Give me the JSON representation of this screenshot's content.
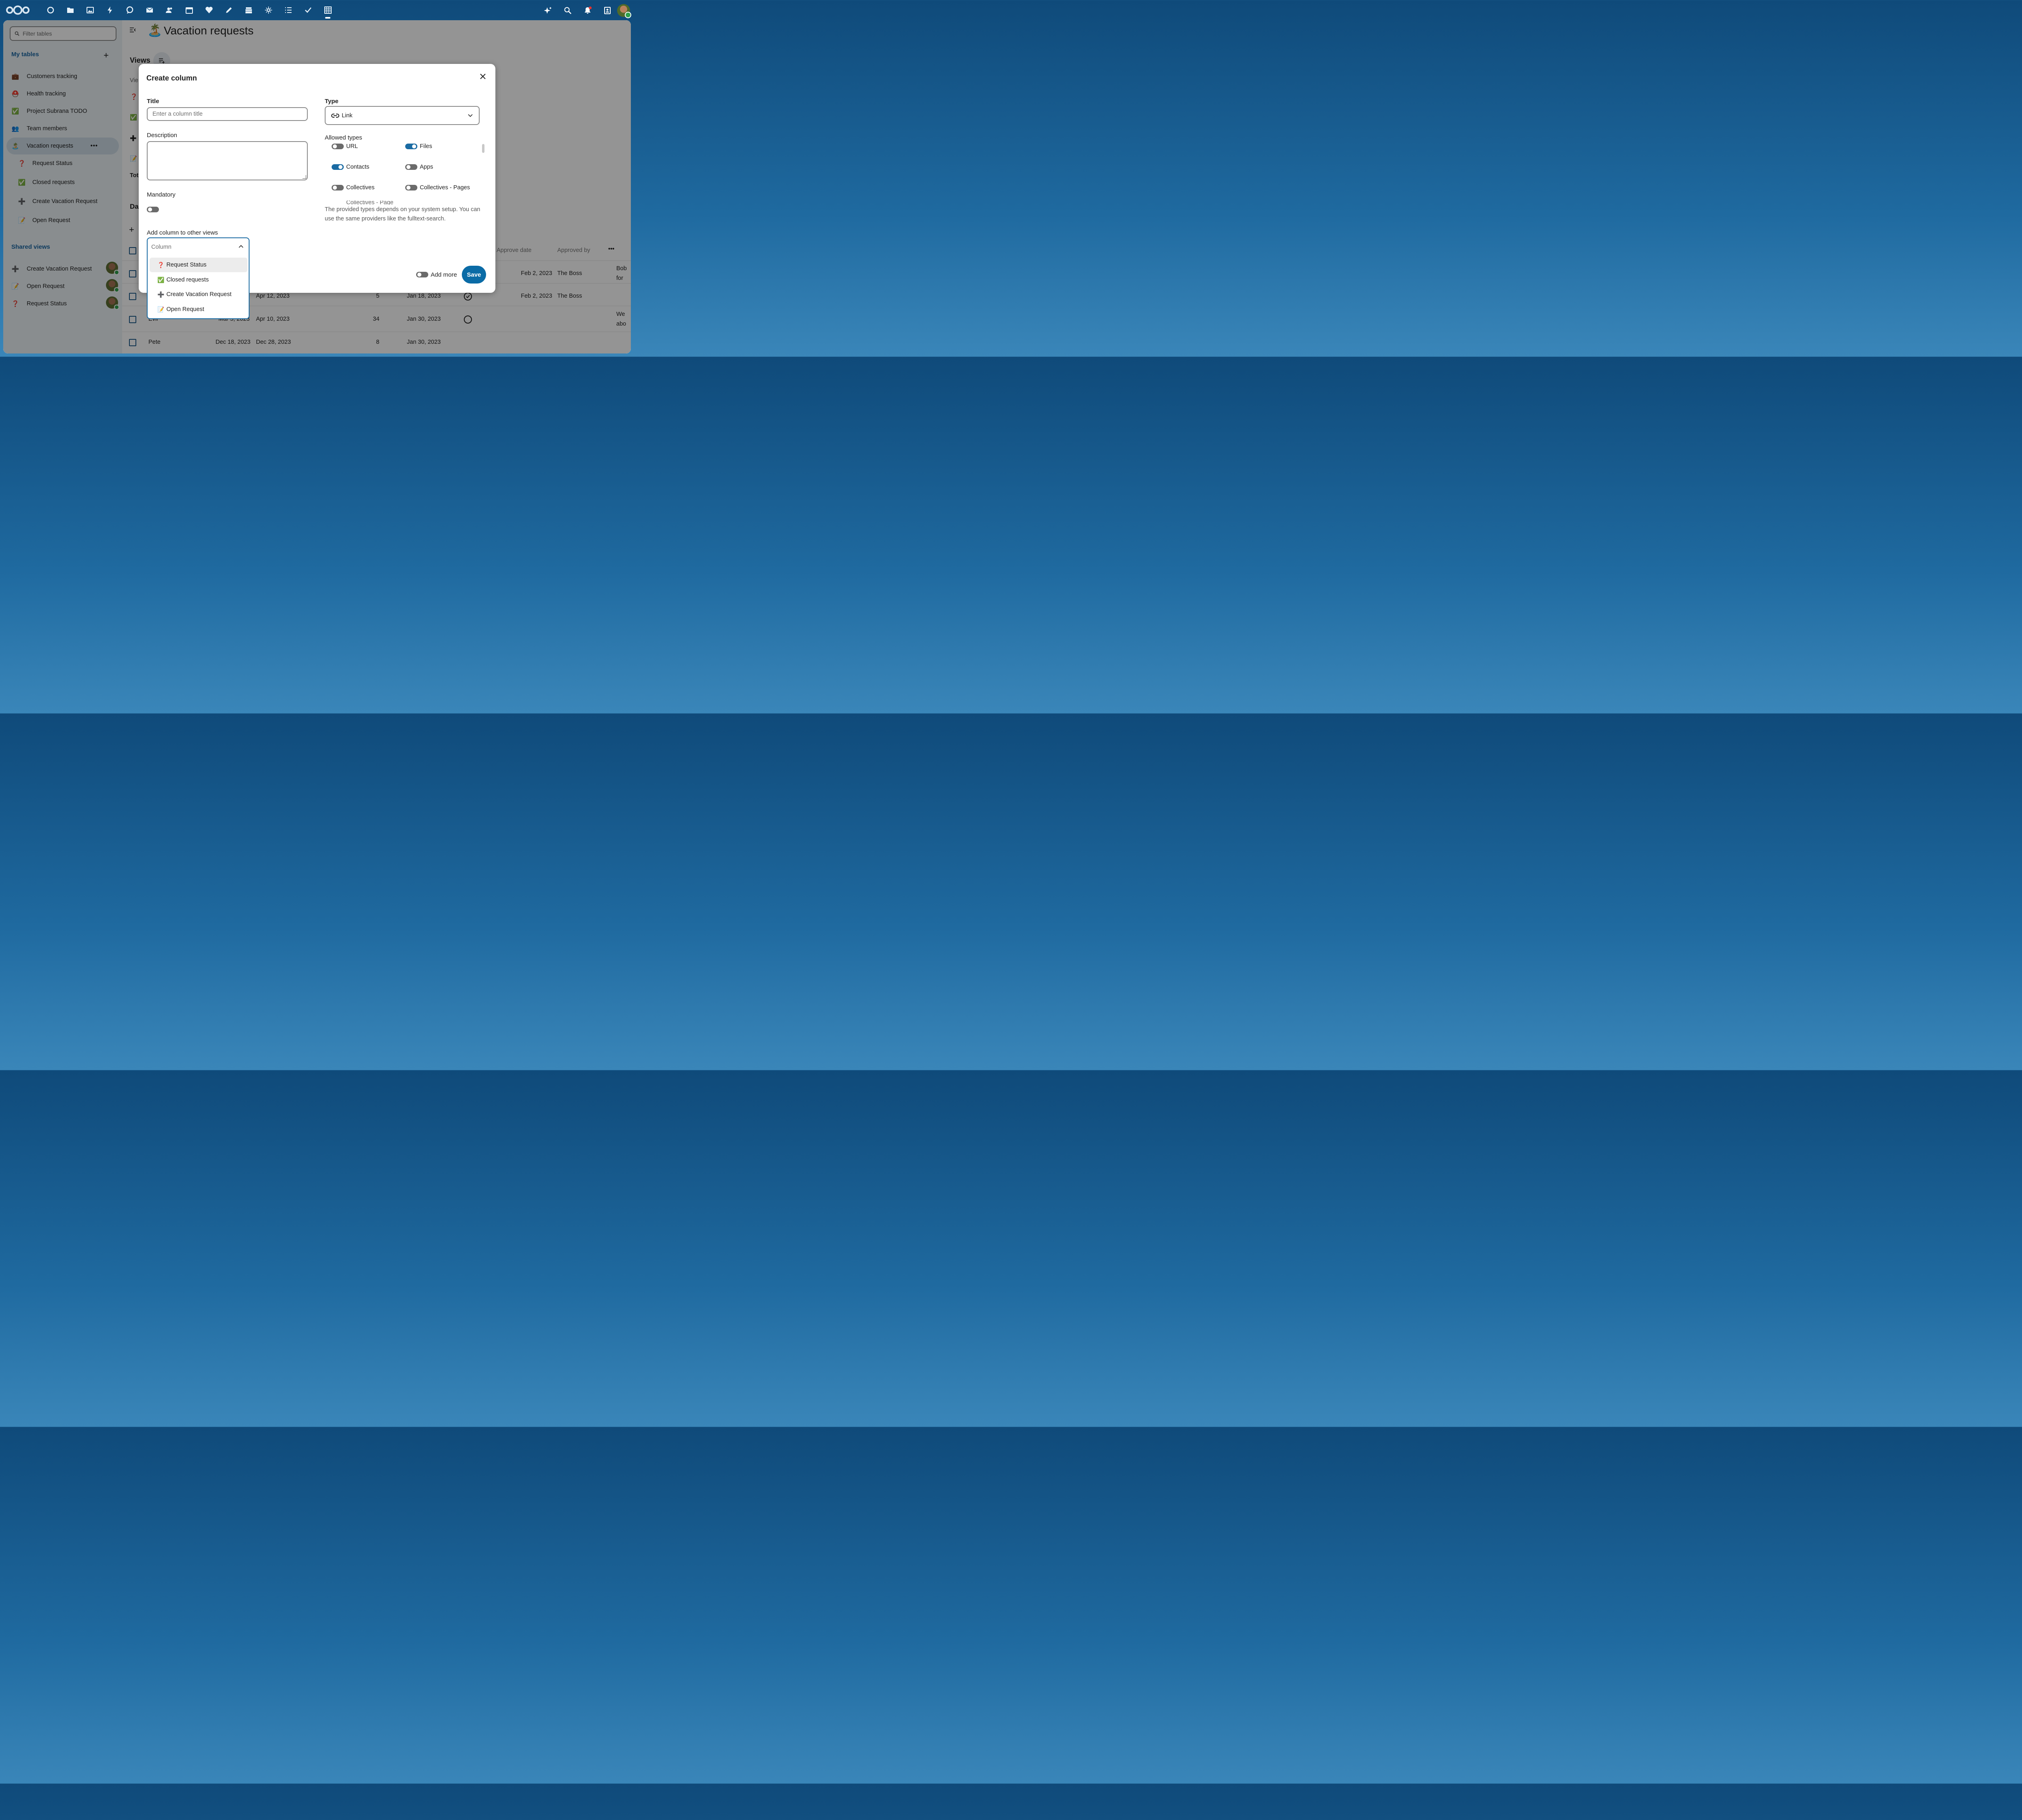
{
  "topbar": {
    "apps": [
      "dashboard-icon",
      "files-icon",
      "photos-icon",
      "activity-icon",
      "talk-icon",
      "mail-icon",
      "contacts-icon",
      "calendar-icon",
      "health-icon",
      "notes-icon",
      "deck-icon",
      "integrations-icon",
      "tasks-list-icon",
      "checks-icon",
      "tables-icon"
    ],
    "active_app": "tables-icon"
  },
  "sidebar": {
    "filter_placeholder": "Filter tables",
    "my_tables_label": "My tables",
    "tables": [
      {
        "emoji": "💼",
        "label": "Customers tracking"
      },
      {
        "emoji": "⛑️",
        "label": "Health tracking"
      },
      {
        "emoji": "✅",
        "label": "Project Subrana TODO"
      },
      {
        "emoji": "👥",
        "label": "Team members"
      },
      {
        "emoji": "🏝️",
        "label": "Vacation requests"
      }
    ],
    "subviews": [
      {
        "emoji": "❓",
        "label": "Request Status"
      },
      {
        "emoji": "✅",
        "label": "Closed requests"
      },
      {
        "emoji": "➕",
        "label": "Create Vacation Request"
      },
      {
        "emoji": "📝",
        "label": "Open Request"
      }
    ],
    "shared_label": "Shared views",
    "shared": [
      {
        "emoji": "➕",
        "label": "Create Vacation Request"
      },
      {
        "emoji": "📝",
        "label": "Open Request"
      },
      {
        "emoji": "❓",
        "label": "Request Status"
      }
    ]
  },
  "main": {
    "emoji": "🏝️",
    "title": "Vacation requests",
    "views_label": "Views",
    "partial": {
      "vie": "Vie",
      "tot": "Tot",
      "da": "Da"
    },
    "headers": {
      "approve_date": "Approve date",
      "approved_by": "Approved by"
    },
    "rows": [
      {
        "name": "",
        "from": "",
        "to": "",
        "days": "",
        "created": "",
        "approve_date": "Feb 2, 2023",
        "approved_by": "The Boss",
        "comment": "Bob",
        "comment2": "for"
      },
      {
        "name": "",
        "from": "",
        "to": "Apr 12, 2023",
        "days": "5",
        "created": "Jan 18, 2023",
        "approve_date": "Feb 2, 2023",
        "approved_by": "The Boss",
        "comment": "",
        "comment2": ""
      },
      {
        "name": "Evil",
        "from": "Mar 5, 2023",
        "to": "Apr 10, 2023",
        "days": "34",
        "created": "Jan 30, 2023",
        "approve_date": "",
        "approved_by": "",
        "comment": "We",
        "comment2": "abo"
      },
      {
        "name": "Pete",
        "from": "Dec 18, 2023",
        "to": "Dec 28, 2023",
        "days": "8",
        "created": "Jan 30, 2023",
        "approve_date": "",
        "approved_by": "",
        "comment": "",
        "comment2": ""
      }
    ]
  },
  "modal": {
    "title": "Create column",
    "title_label": "Title",
    "title_placeholder": "Enter a column title",
    "description_label": "Description",
    "mandatory_label": "Mandatory",
    "add_to_views_label": "Add column to other views",
    "column_placeholder": "Column",
    "view_options": [
      {
        "emoji": "❓",
        "label": "Request Status"
      },
      {
        "emoji": "✅",
        "label": "Closed requests"
      },
      {
        "emoji": "➕",
        "label": "Create Vacation Request"
      },
      {
        "emoji": "📝",
        "label": "Open Request"
      }
    ],
    "type_label": "Type",
    "type_value": "Link",
    "allowed_types_label": "Allowed types",
    "allowed_types": [
      {
        "label": "URL",
        "on": false
      },
      {
        "label": "Files",
        "on": true
      },
      {
        "label": "Contacts",
        "on": true
      },
      {
        "label": "Apps",
        "on": false
      },
      {
        "label": "Collectives",
        "on": false
      },
      {
        "label": "Collectives - Pages",
        "on": false
      }
    ],
    "cut_off_label": "Collectives - Page",
    "help_text": "The provided types depends on your system setup. You can use the same providers like the fulltext-search.",
    "add_more_label": "Add more",
    "save_label": "Save"
  },
  "colors": {
    "primary": "#0a6ba6",
    "link": "#1a66a3"
  }
}
